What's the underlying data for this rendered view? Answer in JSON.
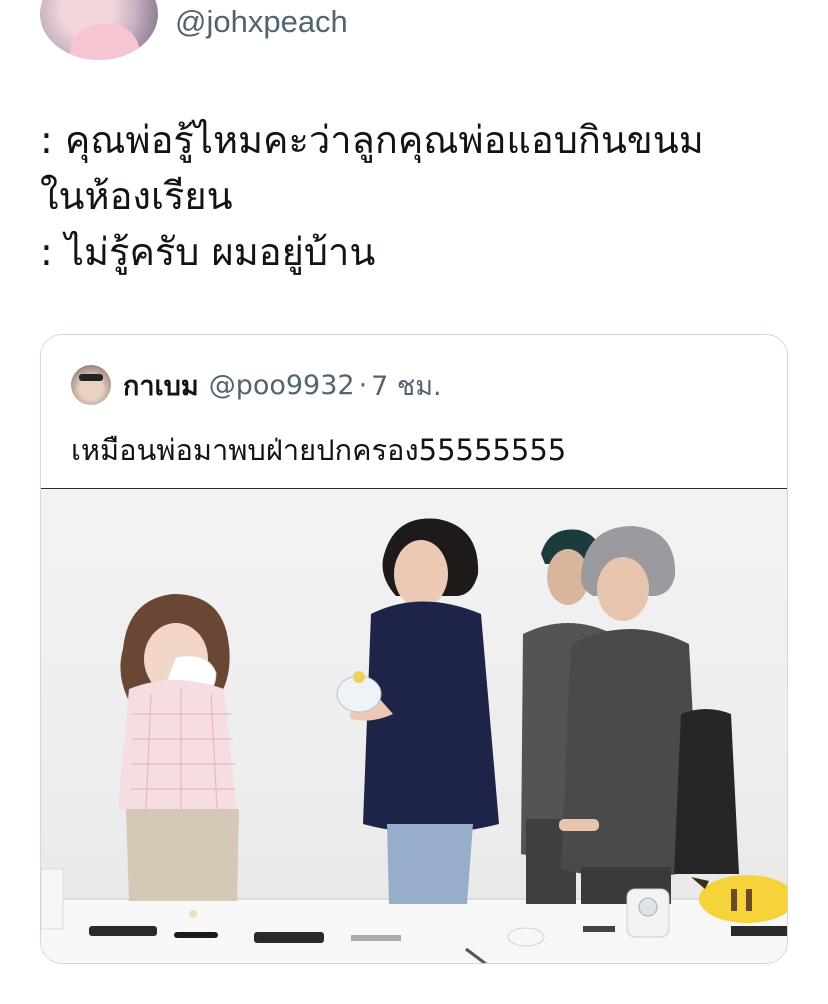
{
  "author": {
    "handle": "@johxpeach"
  },
  "tweet": {
    "lines": [
      ": คุณพ่อรู้ไหมคะว่าลูกคุณพ่อแอบกินขนม",
      "ในห้องเรียน",
      ": ไม่รู้ครับ ผมอยู่บ้าน"
    ]
  },
  "quoted_tweet": {
    "name": "กาเบม",
    "handle": "@poo9932",
    "separator": "·",
    "time": "7 ชม.",
    "text": "เหมือนพ่อมาพบฝ่ายปกครอง55555555"
  },
  "colors": {
    "text": "#0f1419",
    "secondary_text": "#536471",
    "card_border": "#cfd9de"
  }
}
